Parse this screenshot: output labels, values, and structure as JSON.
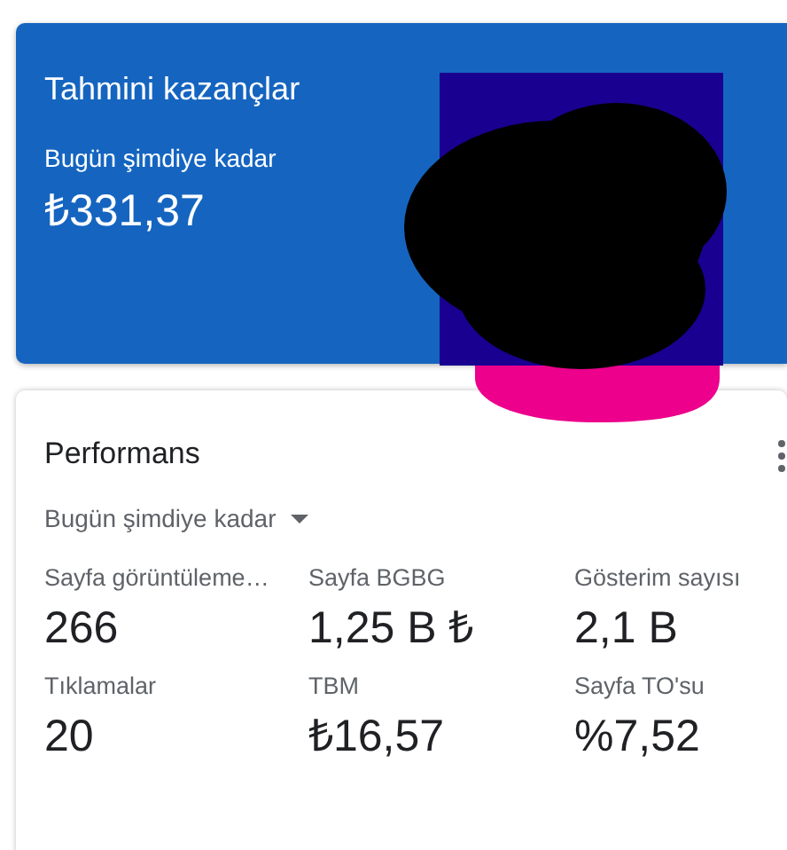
{
  "earnings": {
    "title": "Tahmini kazançlar",
    "period": "Bugün şimdiye kadar",
    "amount": "₺331,37"
  },
  "performance": {
    "title": "Performans",
    "period": "Bugün şimdiye kadar",
    "metrics": [
      {
        "label": "Sayfa görüntüleme…",
        "value": "266"
      },
      {
        "label": "Sayfa BGBG",
        "value": "1,25 B ₺"
      },
      {
        "label": "Gösterim sayısı",
        "value": "2,1 B"
      },
      {
        "label": "Tıklamalar",
        "value": "20"
      },
      {
        "label": "TBM",
        "value": "₺16,57"
      },
      {
        "label": "Sayfa TO'su",
        "value": "%7,52"
      }
    ]
  }
}
